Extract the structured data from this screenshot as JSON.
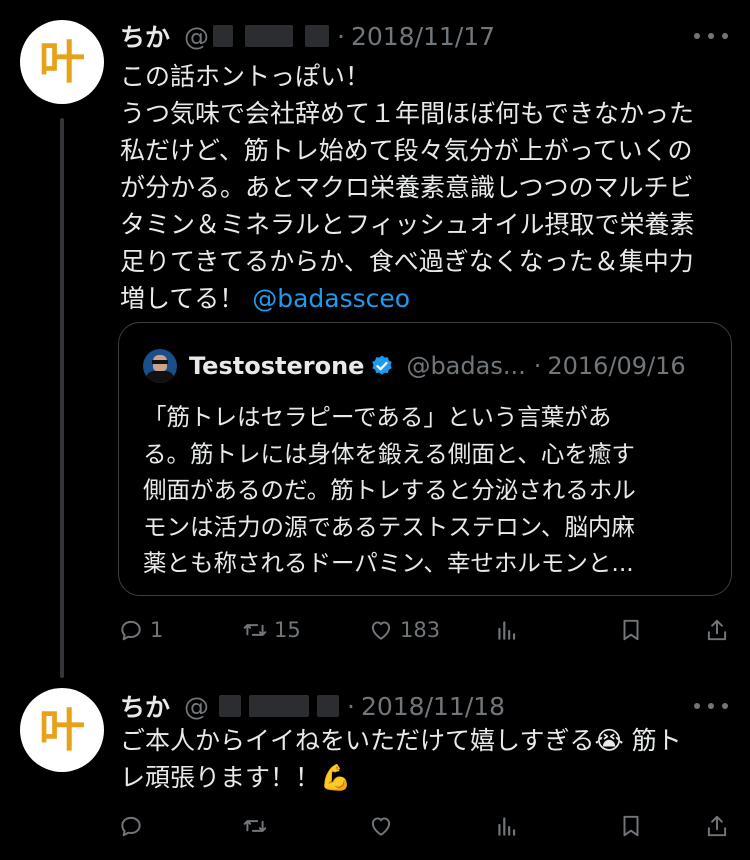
{
  "tweets": [
    {
      "author": "ちか",
      "handle_prefix": "@",
      "date": "2018/11/17",
      "text_lines": [
        "この話ホントっぽい！",
        "うつ気味で会社辞めて１年間ほぼ何もできなかった",
        "私だけど、筋トレ始めて段々気分が上がっていくの",
        "が分かる。あとマクロ栄養素意識しつつのマルチビ",
        "タミン＆ミネラルとフィッシュオイル摂取で栄養素",
        "足りてきてるからか、食べ過ぎなくなった＆集中力",
        "増してる！"
      ],
      "mention": "@badassceo",
      "quote": {
        "name": "Testosterone",
        "handle": "@badas...",
        "date": "2016/09/16",
        "text_lines": [
          "「筋トレはセラピーである」という言葉があ",
          "る。筋トレには身体を鍛える側面と、心を癒す",
          "側面があるのだ。筋トレすると分泌されるホル",
          "モンは活力の源であるテストステロン、脳内麻",
          "薬とも称されるドーパミン、幸せホルモンと..."
        ]
      },
      "stats": {
        "replies": "1",
        "retweets": "15",
        "likes": "183"
      }
    },
    {
      "author": "ちか",
      "handle_prefix": "@",
      "date": "2018/11/18",
      "text_lines": [
        "ご本人からイイねをいただけて嬉しすぎる😭 筋ト",
        "レ頑張ります！！💪"
      ]
    }
  ],
  "avatar_glyph": "叶",
  "separator": "·",
  "icons": [
    "reply-icon",
    "retweet-icon",
    "like-icon",
    "views-icon",
    "bookmark-icon",
    "share-icon",
    "more-icon",
    "verified-badge-icon"
  ],
  "colors": {
    "background": "#000000",
    "text": "#e7e9ea",
    "muted": "#71767b",
    "accent": "#1d9bf0",
    "avatar_glyph": "#e8a21a"
  }
}
